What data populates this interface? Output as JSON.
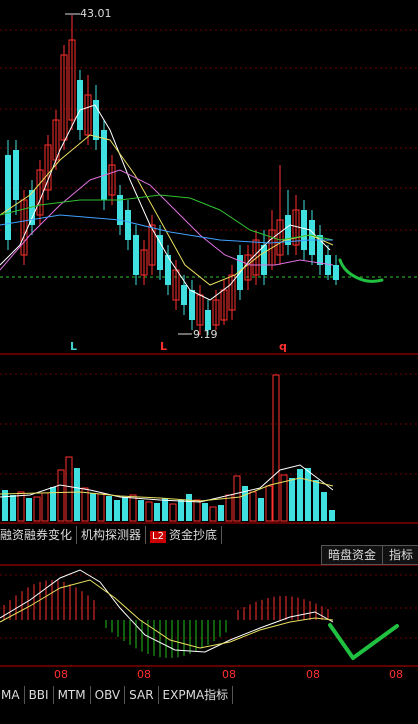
{
  "price_chart": {
    "high_label": "43.01",
    "low_label": "9.19",
    "markers": [
      {
        "text": "L",
        "color": "#40d0d0"
      },
      {
        "text": "L",
        "color": "#ff3030"
      },
      {
        "text": "q",
        "color": "#ff3030"
      }
    ]
  },
  "tabs_top": [
    "融资融券变化",
    "机构探测器",
    "资金抄底"
  ],
  "tab_l2_badge": "L2",
  "tabs_right": [
    "暗盘资金",
    "指标"
  ],
  "date_labels": [
    "08",
    "08",
    "08",
    "08",
    "08"
  ],
  "tabs_bottom": [
    "MA",
    "BBI",
    "MTM",
    "OBV",
    "SAR",
    "EXPMA指标"
  ],
  "colors": {
    "up": "#ff3030",
    "down": "#40e0e0",
    "grid": "#6a0000",
    "ma5": "#ffffff",
    "ma10": "#e8e060",
    "ma20": "#e070e0",
    "ma30": "#30c030",
    "ma60": "#40a0ff",
    "annotation": "#20c040"
  }
}
